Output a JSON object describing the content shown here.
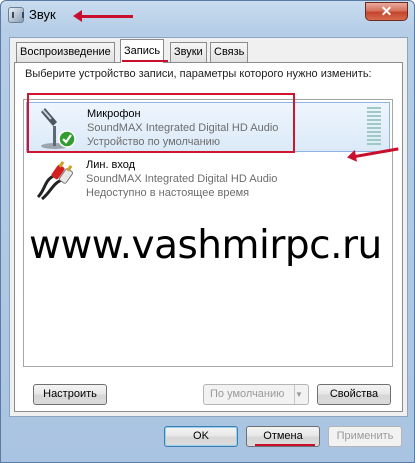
{
  "window": {
    "title": "Звук",
    "close_glyph": "✕"
  },
  "tabs": [
    {
      "label": "Воспроизведение",
      "active": false
    },
    {
      "label": "Запись",
      "active": true
    },
    {
      "label": "Звуки",
      "active": false
    },
    {
      "label": "Связь",
      "active": false
    }
  ],
  "instruction": "Выберите устройство записи, параметры которого нужно изменить:",
  "devices": [
    {
      "name": "Микрофон",
      "driver": "SoundMAX Integrated Digital HD Audio",
      "status": "Устройство по умолчанию",
      "selected": true,
      "icon": "microphone-icon",
      "badge": "default-check-icon"
    },
    {
      "name": "Лин. вход",
      "driver": "SoundMAX Integrated Digital HD Audio",
      "status": "Недоступно в настоящее время",
      "selected": false,
      "icon": "rca-cable-icon"
    }
  ],
  "watermark": "www.vashmirpc.ru",
  "buttons": {
    "configure": "Настроить",
    "set_default": "По умолчанию",
    "properties": "Свойства",
    "ok": "OK",
    "cancel": "Отмена",
    "apply": "Применить"
  },
  "colors": {
    "annotation_red": "#c8102e",
    "selection_blue": "#8db2e3",
    "check_green": "#2f9e2f"
  }
}
